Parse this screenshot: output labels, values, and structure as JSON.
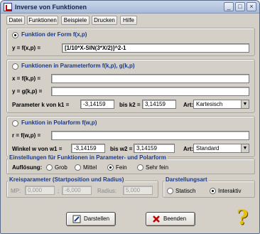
{
  "window": {
    "title": "Inverse von Funktionen"
  },
  "menu": [
    "Datei",
    "Funktionen",
    "Beispiele",
    "Drucken",
    "Hilfe"
  ],
  "section_fx": {
    "title": "Funktion der Form f(x,p)",
    "label": "y = f(x,p) =",
    "value": "[1/10*X-SIN(3*X/2)]^2-1",
    "selected": true
  },
  "section_param": {
    "title": "Funktionen in Parameterform f(k,p), g(k,p)",
    "x_label": "x = f(k,p) =",
    "x_value": "",
    "y_label": "y = g(k,p) =",
    "y_value": "",
    "range_label": "Parameter k von k1 =",
    "k1": "-3,14159",
    "to_label": "bis k2 =",
    "k2": "3,14159",
    "art_label": "Art:",
    "art_value": "Kartesisch",
    "selected": false
  },
  "section_polar": {
    "title": "Funktion in Polarform f(w,p)",
    "r_label": "r = f(w,p) =",
    "r_value": "",
    "range_label": "Winkel w von w1 =",
    "w1": "-3,14159",
    "to_label": "bis w2 =",
    "w2": "3,14159",
    "art_label": "Art:",
    "art_value": "Standard",
    "selected": false
  },
  "settings": {
    "legend": "Einstellungen für Funktionen in Parameter- und Polarform",
    "label": "Auflösung:",
    "options": [
      "Grob",
      "Mittel",
      "Fein",
      "Sehr fein"
    ],
    "selected_index": 2
  },
  "circle": {
    "legend": "Kreisparameter (Startposition und Radius)",
    "mp_label": "MP:",
    "mp_x": "0,000",
    "sep": ";",
    "mp_y": "-6,000",
    "radius_label": "Radius:",
    "radius": "5,000"
  },
  "display": {
    "legend": "Darstellungsart",
    "options": [
      "Statisch",
      "Interaktiv"
    ],
    "selected_index": 1
  },
  "buttons": {
    "draw": "Darstellen",
    "quit": "Beenden"
  },
  "colors": {
    "accent": "#1a3a8a",
    "title_bar": "#b5c5e0"
  }
}
